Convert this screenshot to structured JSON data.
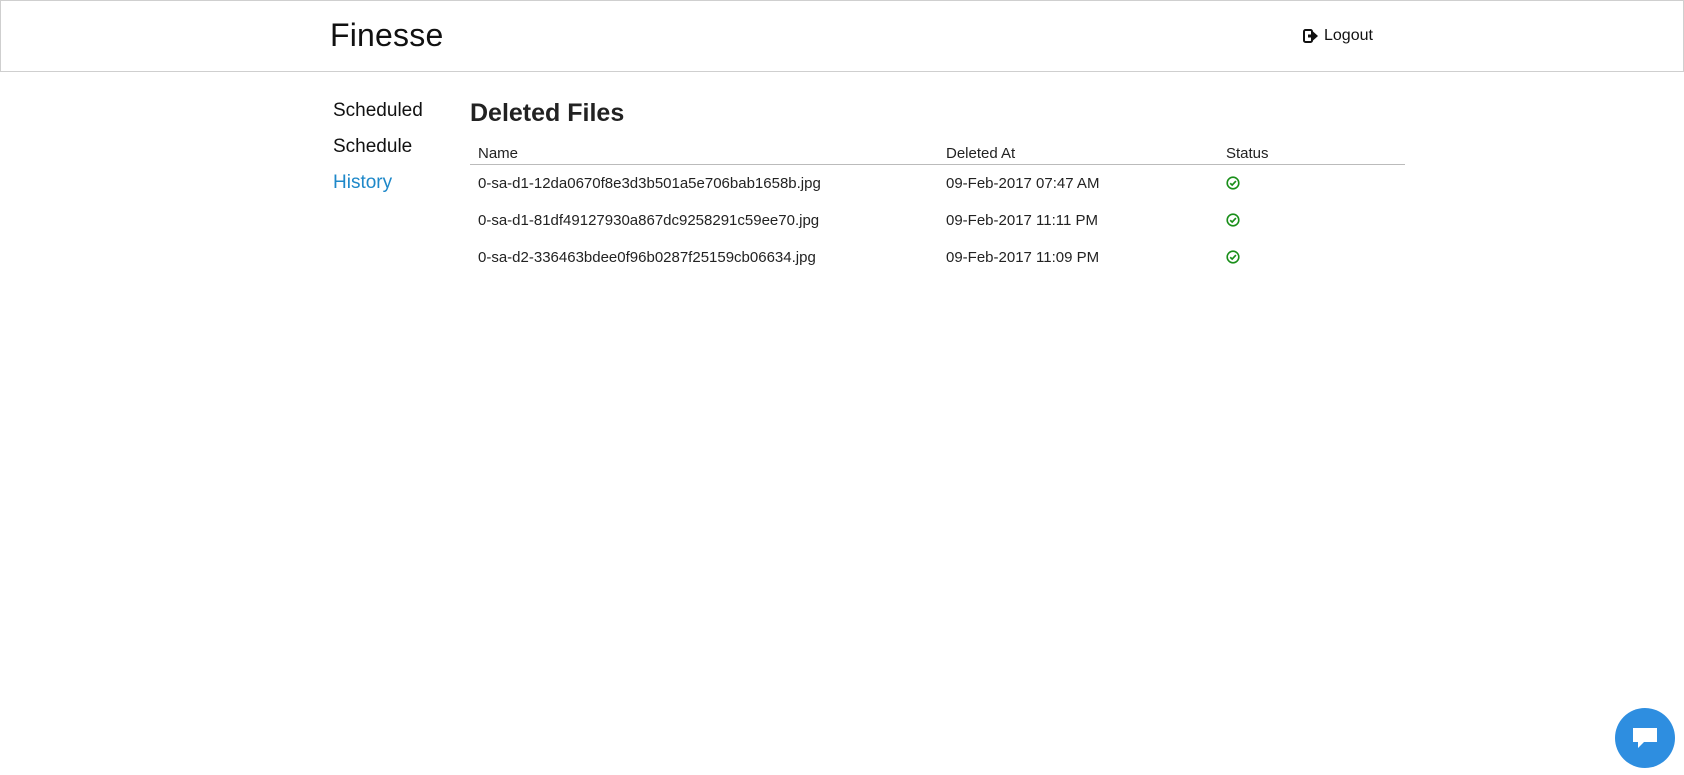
{
  "header": {
    "brand": "Finesse",
    "logout_label": "Logout"
  },
  "sidebar": {
    "items": [
      {
        "label": "Scheduled",
        "active": false
      },
      {
        "label": "Schedule",
        "active": false
      },
      {
        "label": "History",
        "active": true
      }
    ]
  },
  "main": {
    "title": "Deleted Files",
    "table": {
      "columns": [
        "Name",
        "Deleted At",
        "Status"
      ],
      "rows": [
        {
          "name": "0-sa-d1-12da0670f8e3d3b501a5e706bab1658b.jpg",
          "deleted_at": "09-Feb-2017 07:47 AM",
          "status": "success-check-icon"
        },
        {
          "name": "0-sa-d1-81df49127930a867dc9258291c59ee70.jpg",
          "deleted_at": "09-Feb-2017 11:11 PM",
          "status": "success-check-icon"
        },
        {
          "name": "0-sa-d2-336463bdee0f96b0287f25159cb06634.jpg",
          "deleted_at": "09-Feb-2017 11:09 PM",
          "status": "success-check-icon"
        }
      ]
    }
  },
  "chat": {
    "icon": "chat-bubble-icon"
  },
  "colors": {
    "accent": "#1e88c9",
    "success": "#1a8f1a",
    "chat": "#2e8ee0"
  }
}
